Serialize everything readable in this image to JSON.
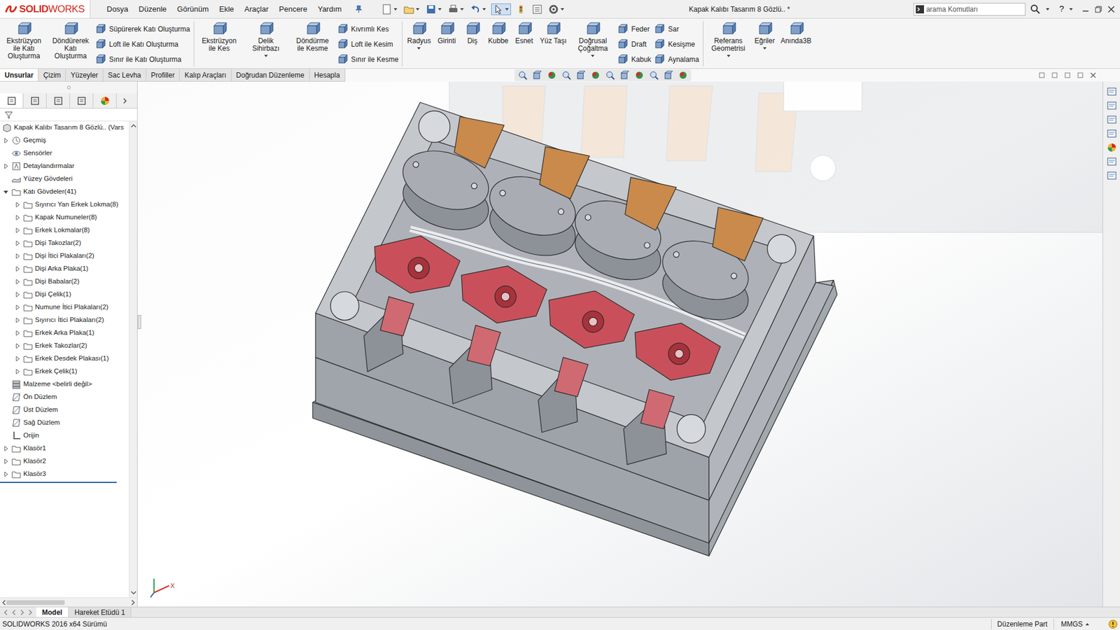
{
  "app": {
    "logo_bold": "SOLID",
    "logo_rest": "WORKS"
  },
  "menu": [
    "Dosya",
    "Düzenle",
    "Görünüm",
    "Ekle",
    "Araçlar",
    "Pencere",
    "Yardım"
  ],
  "window": {
    "title": "Kapak Kalıbı Tasarım 8 Gözlü.. *"
  },
  "search": {
    "placeholder": "arama Komutları"
  },
  "help": "?",
  "ribbon": [
    [
      {
        "kind": "large",
        "label": "Ekstrüzyon ile Katı Oluşturma",
        "menu": false
      },
      {
        "kind": "large",
        "label": "Döndürerek Katı Oluşturma",
        "menu": false
      },
      {
        "kind": "column",
        "items": [
          "Süpürerek Katı Oluşturma",
          "Loft ile Katı Oluşturma",
          "Sınır ile Katı Oluşturma"
        ]
      }
    ],
    [
      {
        "kind": "large",
        "label": "Ekstrüzyon ile Kes",
        "menu": false
      },
      {
        "kind": "large",
        "label": "Delik Sihirbazı",
        "menu": true
      },
      {
        "kind": "large",
        "label": "Döndürme ile Kesme",
        "menu": false
      },
      {
        "kind": "column",
        "items": [
          "Kıvrımlı Kes",
          "Loft ile Kesim",
          "Sınır ile Kesme"
        ]
      }
    ],
    [
      {
        "kind": "large",
        "label": "Radyus",
        "menu": true
      },
      {
        "kind": "large",
        "label": "Girinti",
        "menu": false
      },
      {
        "kind": "large",
        "label": "Diş",
        "menu": false
      },
      {
        "kind": "large",
        "label": "Kubbe",
        "menu": false
      },
      {
        "kind": "large",
        "label": "Esnet",
        "menu": false
      },
      {
        "kind": "large",
        "label": "Yüz Taşı",
        "menu": false
      },
      {
        "kind": "large",
        "label": "Doğrusal Çoğaltma",
        "menu": true
      },
      {
        "kind": "column",
        "items": [
          "Feder",
          "Draft",
          "Kabuk"
        ]
      },
      {
        "kind": "column",
        "items": [
          "Sar",
          "Kesişme",
          "Aynalama"
        ]
      }
    ],
    [
      {
        "kind": "large",
        "label": "Referans Geometrisi",
        "menu": true
      },
      {
        "kind": "large",
        "label": "Eğriler",
        "menu": true
      },
      {
        "kind": "large",
        "label": "Anında3B",
        "menu": false
      }
    ]
  ],
  "command_tabs": [
    {
      "label": "Unsurlar",
      "selected": true
    },
    {
      "label": "Çizim",
      "selected": false
    },
    {
      "label": "Yüzeyler",
      "selected": false
    },
    {
      "label": "Sac Levha",
      "selected": false
    },
    {
      "label": "Profiller",
      "selected": false
    },
    {
      "label": "Kalıp Araçları",
      "selected": false
    },
    {
      "label": "Doğrudan Düzenleme",
      "selected": false
    },
    {
      "label": "Hesapla",
      "selected": false
    }
  ],
  "tree": {
    "root": "Kapak Kalıbı Tasarım 8 Gözlü.. (Vars",
    "items": [
      {
        "label": "Geçmiş",
        "depth": 0,
        "kind": "history",
        "expandable": true,
        "expanded": false
      },
      {
        "label": "Sensörler",
        "depth": 0,
        "kind": "sensor",
        "expandable": false,
        "expanded": false
      },
      {
        "label": "Detaylandırmalar",
        "depth": 0,
        "kind": "annotation",
        "expandable": true,
        "expanded": false
      },
      {
        "label": "Yüzey Gövdeleri",
        "depth": 0,
        "kind": "surface",
        "expandable": false,
        "expanded": false
      },
      {
        "label": "Katı Gövdeler(41)",
        "depth": 0,
        "kind": "solid",
        "expandable": true,
        "expanded": true
      },
      {
        "label": "Sıyırıcı Yan Erkek Lokma(8)",
        "depth": 1,
        "kind": "folder",
        "expandable": true,
        "expanded": false
      },
      {
        "label": "Kapak Numuneler(8)",
        "depth": 1,
        "kind": "folder",
        "expandable": true,
        "expanded": false
      },
      {
        "label": "Erkek Lokmalar(8)",
        "depth": 1,
        "kind": "folder",
        "expandable": true,
        "expanded": false
      },
      {
        "label": "Dişi Takozlar(2)",
        "depth": 1,
        "kind": "folder",
        "expandable": true,
        "expanded": false
      },
      {
        "label": "Dişi İtici Plakaları(2)",
        "depth": 1,
        "kind": "folder",
        "expandable": true,
        "expanded": false
      },
      {
        "label": "Dişi Arka Plaka(1)",
        "depth": 1,
        "kind": "folder",
        "expandable": true,
        "expanded": false
      },
      {
        "label": "Dişi Babalar(2)",
        "depth": 1,
        "kind": "folder",
        "expandable": true,
        "expanded": false
      },
      {
        "label": "Dişi Çelik(1)",
        "depth": 1,
        "kind": "folder",
        "expandable": true,
        "expanded": false
      },
      {
        "label": "Numune İtici Plakaları(2)",
        "depth": 1,
        "kind": "folder",
        "expandable": true,
        "expanded": false
      },
      {
        "label": "Sıyırıcı İtici Plakaları(2)",
        "depth": 1,
        "kind": "folder",
        "expandable": true,
        "expanded": false
      },
      {
        "label": "Erkek Arka Plaka(1)",
        "depth": 1,
        "kind": "folder",
        "expandable": true,
        "expanded": false
      },
      {
        "label": "Erkek Takozlar(2)",
        "depth": 1,
        "kind": "folder",
        "expandable": true,
        "expanded": false
      },
      {
        "label": "Erkek Desdek Plakası(1)",
        "depth": 1,
        "kind": "folder",
        "expandable": true,
        "expanded": false
      },
      {
        "label": "Erkek Çelik(1)",
        "depth": 1,
        "kind": "folder",
        "expandable": true,
        "expanded": false
      },
      {
        "label": "Malzeme <belirli değil>",
        "depth": 0,
        "kind": "material",
        "expandable": false,
        "expanded": false
      },
      {
        "label": "Ön Düzlem",
        "depth": 0,
        "kind": "plane",
        "expandable": false,
        "expanded": false
      },
      {
        "label": "Üst Düzlem",
        "depth": 0,
        "kind": "plane",
        "expandable": false,
        "expanded": false
      },
      {
        "label": "Sağ Düzlem",
        "depth": 0,
        "kind": "plane",
        "expandable": false,
        "expanded": false
      },
      {
        "label": "Orijin",
        "depth": 0,
        "kind": "origin",
        "expandable": false,
        "expanded": false
      },
      {
        "label": "Klasör1",
        "depth": 0,
        "kind": "folder",
        "expandable": true,
        "expanded": false
      },
      {
        "label": "Klasör2",
        "depth": 0,
        "kind": "folder",
        "expandable": true,
        "expanded": false
      },
      {
        "label": "Klasör3",
        "depth": 0,
        "kind": "folder",
        "expandable": true,
        "expanded": false
      }
    ]
  },
  "triad": {
    "x": "X"
  },
  "bottom_tabs": [
    {
      "label": "Model",
      "selected": true
    },
    {
      "label": "Hareket Etüdü 1",
      "selected": false
    }
  ],
  "status_bar": {
    "version": "SOLIDWORKS 2016 x64 Sürümü",
    "mode": "Düzenleme Part",
    "units": "MMGS"
  }
}
